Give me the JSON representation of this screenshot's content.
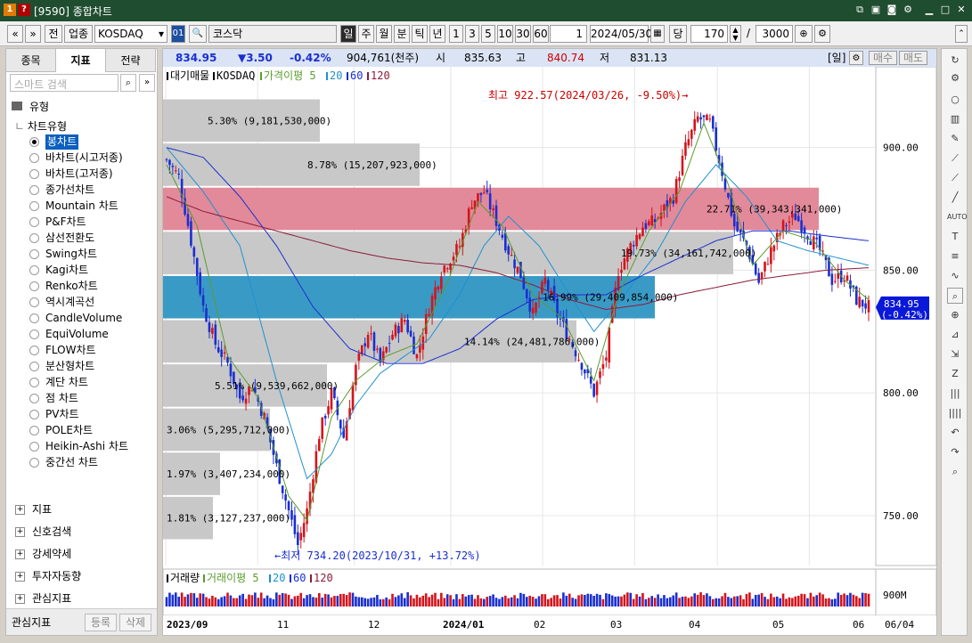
{
  "window": {
    "title": "[9590] 종합차트",
    "icons": [
      "restore-icon",
      "window-icon",
      "copy-icon",
      "camera-icon",
      "gear-icon",
      "minimize-icon",
      "maximize-icon",
      "close-icon"
    ]
  },
  "toolbar": {
    "prev": "«",
    "next": "»",
    "jeon": "전",
    "market_kind": "업종",
    "code": "KOSDAQ",
    "code_btn": "01",
    "search_icon": "🔍",
    "name": "코스닥",
    "periods": [
      "일",
      "주",
      "월",
      "분",
      "틱",
      "년"
    ],
    "active_period": "일",
    "multipliers": [
      "1",
      "3",
      "5",
      "10",
      "30",
      "60"
    ],
    "count_box": "1",
    "date": "2024/05/30",
    "dang": "당",
    "view_count": "170",
    "slash": "/",
    "total": "3000"
  },
  "left": {
    "tabs": [
      "종목",
      "지표",
      "전략"
    ],
    "active_tab": "지표",
    "search_placeholder": "스마트 검색",
    "root": "유형",
    "group": "차트유형",
    "chart_types": [
      "봉차트",
      "바차트(시고저종)",
      "바차트(고저종)",
      "종가선차트",
      "Mountain 차트",
      "P&F차트",
      "삼선전환도",
      "Swing차트",
      "Kagi차트",
      "Renko차트",
      "역시계곡선",
      "CandleVolume",
      "EquiVolume",
      "FLOW차트",
      "분산형차트",
      "계단 차트",
      "점 차트",
      "PV차트",
      "POLE차트",
      "Heikin-Ashi 차트",
      "중간선 차트"
    ],
    "selected_type": "봉차트",
    "folders": [
      "지표",
      "신호검색",
      "강세약세",
      "투자자동향",
      "관심지표"
    ],
    "bottom_label": "관심지표",
    "btn_register": "등록",
    "btn_delete": "삭제"
  },
  "info": {
    "price": "834.95",
    "change": "▼3.50",
    "pct": "-0.42%",
    "volume": "904,761(천주)",
    "open_l": "시",
    "open": "835.63",
    "high_l": "고",
    "high": "840.74",
    "low_l": "저",
    "low": "831.13",
    "period_tag": "[일]",
    "buy": "매수",
    "sell": "매도"
  },
  "legend": {
    "items": [
      "대기매물",
      "KOSDAQ",
      "가격이평 5",
      "20",
      "60",
      "120"
    ],
    "colors": [
      "#000",
      "#000",
      "#5a9d2c",
      "#1e90d0",
      "#1a2fd0",
      "#8b1c3a"
    ]
  },
  "vol_legend": {
    "items": [
      "거래량",
      "거래이평 5",
      "20",
      "60",
      "120"
    ]
  },
  "chart_data": {
    "type": "candlestick",
    "ylim": [
      734,
      930
    ],
    "y_ticks": [
      "900.00",
      "850.00",
      "800.00",
      "750.00"
    ],
    "y_tick_values": [
      900,
      850,
      800,
      750
    ],
    "x_ticks": [
      "2023/09",
      "11",
      "12",
      "2024/01",
      "02",
      "03",
      "04",
      "05",
      "06"
    ],
    "current_price_label": [
      "834.95",
      "(-0.42%)"
    ],
    "high_annotation": "최고 922.57(2024/03/26, -9.50%)→",
    "low_annotation": "←최저 734.20(2023/10/31, +13.72%)",
    "volume_profile": [
      {
        "pct": "5.30%",
        "amount": "9,181,530,000",
        "low": 902,
        "high": 920,
        "len": 0.22
      },
      {
        "pct": "8.78%",
        "amount": "15,207,923,000",
        "low": 884,
        "high": 902,
        "len": 0.36
      },
      {
        "pct": "22.71%",
        "amount": "39,343,341,000",
        "low": 866,
        "high": 884,
        "len": 0.92,
        "highlight": "#e28a9a"
      },
      {
        "pct": "19.73%",
        "amount": "34,161,742,000",
        "low": 848,
        "high": 866,
        "len": 0.8
      },
      {
        "pct": "16.99%",
        "amount": "29,409,854,000",
        "low": 830,
        "high": 848,
        "len": 0.69,
        "highlight": "#3a9ac6"
      },
      {
        "pct": "14.14%",
        "amount": "24,481,786,000",
        "low": 812,
        "high": 830,
        "len": 0.58
      },
      {
        "pct": "5.51%",
        "amount": "9,539,662,000",
        "low": 794,
        "high": 812,
        "len": 0.23
      },
      {
        "pct": "3.06%",
        "amount": "5,295,712,000",
        "low": 776,
        "high": 794,
        "len": 0.15
      },
      {
        "pct": "1.97%",
        "amount": "3,407,234,000",
        "low": 758,
        "high": 776,
        "len": 0.08
      },
      {
        "pct": "1.81%",
        "amount": "3,127,237,000",
        "low": 740,
        "high": 758,
        "len": 0.07
      }
    ],
    "close_path": [
      [
        0,
        895
      ],
      [
        4,
        888
      ],
      [
        8,
        862
      ],
      [
        12,
        835
      ],
      [
        16,
        820
      ],
      [
        20,
        812
      ],
      [
        24,
        798
      ],
      [
        28,
        803
      ],
      [
        32,
        790
      ],
      [
        36,
        770
      ],
      [
        40,
        752
      ],
      [
        43,
        738
      ],
      [
        46,
        752
      ],
      [
        50,
        783
      ],
      [
        54,
        800
      ],
      [
        58,
        782
      ],
      [
        62,
        810
      ],
      [
        66,
        825
      ],
      [
        70,
        812
      ],
      [
        74,
        824
      ],
      [
        78,
        830
      ],
      [
        82,
        815
      ],
      [
        86,
        835
      ],
      [
        90,
        850
      ],
      [
        96,
        860
      ],
      [
        100,
        878
      ],
      [
        104,
        882
      ],
      [
        108,
        870
      ],
      [
        112,
        858
      ],
      [
        116,
        848
      ],
      [
        120,
        832
      ],
      [
        124,
        846
      ],
      [
        128,
        832
      ],
      [
        132,
        822
      ],
      [
        136,
        812
      ],
      [
        140,
        800
      ],
      [
        144,
        815
      ],
      [
        148,
        850
      ],
      [
        152,
        860
      ],
      [
        156,
        868
      ],
      [
        160,
        870
      ],
      [
        166,
        880
      ],
      [
        170,
        900
      ],
      [
        174,
        912
      ],
      [
        178,
        910
      ],
      [
        182,
        890
      ],
      [
        186,
        868
      ],
      [
        190,
        860
      ],
      [
        194,
        845
      ],
      [
        198,
        858
      ],
      [
        202,
        868
      ],
      [
        206,
        872
      ],
      [
        210,
        865
      ],
      [
        214,
        858
      ],
      [
        218,
        846
      ],
      [
        222,
        848
      ],
      [
        226,
        838
      ],
      [
        230,
        835
      ]
    ],
    "ma_series": [
      {
        "name": "20",
        "color": "#1e90d0",
        "points": [
          [
            0,
            900
          ],
          [
            12,
            882
          ],
          [
            24,
            860
          ],
          [
            36,
            805
          ],
          [
            46,
            765
          ],
          [
            54,
            775
          ],
          [
            62,
            795
          ],
          [
            70,
            808
          ],
          [
            78,
            815
          ],
          [
            86,
            822
          ],
          [
            96,
            840
          ],
          [
            104,
            860
          ],
          [
            112,
            872
          ],
          [
            122,
            860
          ],
          [
            132,
            840
          ],
          [
            140,
            825
          ],
          [
            150,
            840
          ],
          [
            160,
            856
          ],
          [
            170,
            878
          ],
          [
            180,
            893
          ],
          [
            190,
            880
          ],
          [
            200,
            862
          ],
          [
            210,
            858
          ],
          [
            220,
            855
          ],
          [
            230,
            852
          ]
        ]
      },
      {
        "name": "60",
        "color": "#1a2fd0",
        "points": [
          [
            0,
            900
          ],
          [
            12,
            896
          ],
          [
            24,
            880
          ],
          [
            36,
            860
          ],
          [
            48,
            835
          ],
          [
            60,
            818
          ],
          [
            72,
            812
          ],
          [
            84,
            812
          ],
          [
            96,
            818
          ],
          [
            108,
            830
          ],
          [
            120,
            838
          ],
          [
            132,
            840
          ],
          [
            144,
            840
          ],
          [
            156,
            848
          ],
          [
            168,
            855
          ],
          [
            180,
            862
          ],
          [
            192,
            866
          ],
          [
            204,
            866
          ],
          [
            216,
            864
          ],
          [
            230,
            862
          ]
        ]
      },
      {
        "name": "120",
        "color": "#8b1c3a",
        "points": [
          [
            0,
            880
          ],
          [
            12,
            874
          ],
          [
            24,
            870
          ],
          [
            36,
            866
          ],
          [
            48,
            862
          ],
          [
            60,
            858
          ],
          [
            72,
            855
          ],
          [
            84,
            853
          ],
          [
            96,
            852
          ],
          [
            108,
            849
          ],
          [
            120,
            844
          ],
          [
            132,
            838
          ],
          [
            144,
            834
          ],
          [
            156,
            836
          ],
          [
            168,
            840
          ],
          [
            180,
            843
          ],
          [
            192,
            846
          ],
          [
            204,
            848
          ],
          [
            216,
            850
          ],
          [
            230,
            851
          ]
        ]
      },
      {
        "name": "5",
        "color": "#5a9d2c",
        "points": [
          [
            0,
            893
          ],
          [
            10,
            868
          ],
          [
            20,
            815
          ],
          [
            30,
            798
          ],
          [
            40,
            758
          ],
          [
            46,
            748
          ],
          [
            54,
            790
          ],
          [
            62,
            805
          ],
          [
            72,
            815
          ],
          [
            82,
            820
          ],
          [
            92,
            845
          ],
          [
            102,
            878
          ],
          [
            110,
            868
          ],
          [
            120,
            840
          ],
          [
            130,
            830
          ],
          [
            140,
            805
          ],
          [
            148,
            840
          ],
          [
            158,
            866
          ],
          [
            168,
            882
          ],
          [
            176,
            910
          ],
          [
            184,
            885
          ],
          [
            192,
            852
          ],
          [
            202,
            866
          ],
          [
            212,
            862
          ],
          [
            222,
            846
          ],
          [
            230,
            838
          ]
        ]
      }
    ]
  },
  "bottom": {
    "vol_tick": "900M",
    "date_box": "06/04"
  }
}
